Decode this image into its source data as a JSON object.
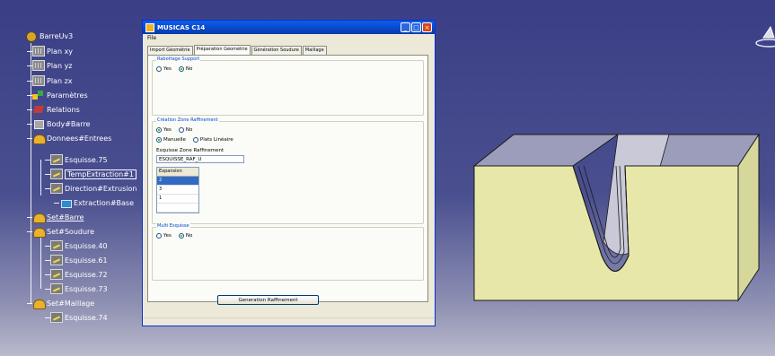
{
  "spec_tree": {
    "root": "BarreUv3",
    "items": [
      {
        "label": "Plan xy",
        "icon": "plane-icon"
      },
      {
        "label": "Plan yz",
        "icon": "plane-icon"
      },
      {
        "label": "Plan zx",
        "icon": "plane-icon"
      },
      {
        "label": "Paramètres",
        "icon": "parameters-icon"
      },
      {
        "label": "Relations",
        "icon": "relations-icon"
      },
      {
        "label": "Body#Barre",
        "icon": "body-icon"
      },
      {
        "label": "Donnees#Entrees",
        "icon": "geometrical-set-icon"
      },
      {
        "label": "Esquisse.75",
        "icon": "sketch-icon"
      },
      {
        "label": "TempExtraction#1",
        "icon": "sketch-icon"
      },
      {
        "label": "Direction#Extrusion",
        "icon": "sketch-icon"
      },
      {
        "label": "Extraction#Base",
        "icon": "extraction-icon"
      },
      {
        "label": "Set#Barre",
        "icon": "geometrical-set-icon"
      },
      {
        "label": "Set#Soudure",
        "icon": "geometrical-set-icon"
      },
      {
        "label": "Esquisse.40",
        "icon": "sketch-icon"
      },
      {
        "label": "Esquisse.61",
        "icon": "sketch-icon"
      },
      {
        "label": "Esquisse.72",
        "icon": "sketch-icon"
      },
      {
        "label": "Esquisse.73",
        "icon": "sketch-icon"
      },
      {
        "label": "Set#Maillage",
        "icon": "geometrical-set-icon"
      },
      {
        "label": "Esquisse.74",
        "icon": "sketch-icon"
      }
    ]
  },
  "dialog": {
    "title": "MUSICAS C14",
    "menu": "File",
    "tabs": [
      "Import Géométrie",
      "Préparation Géométrie",
      "Génération Soudure",
      "Maillage"
    ],
    "active_tab": "Préparation Géométrie",
    "rabotage": {
      "title": "Rabottage Support",
      "options": [
        "Yes",
        "No"
      ],
      "selected": "No"
    },
    "raffinement": {
      "title": "Création Zone Raffinement",
      "options": [
        "Yes",
        "No"
      ],
      "selected": "Yes",
      "type_options": [
        "Manuelle",
        "Plats Linéaire"
      ],
      "type_selected": "Manuelle",
      "sketch_label": "Esquisse Zone Raffinement",
      "sketch_value": "ESQUISSE_RAF_U",
      "table_header": "Expansion",
      "table_rows": [
        "2",
        "3",
        "1",
        ""
      ],
      "selected_row": 0
    },
    "multi_esquisse": {
      "title": "Multi Esquisse",
      "options": [
        "Yes",
        "No"
      ],
      "selected": "No"
    },
    "generate_button": "Generation Raffinement"
  },
  "colors": {
    "model_face_light": "#e6e7a8",
    "model_face_top": "#9b9dba",
    "background_top": "#3a3f86",
    "background_bottom": "#b9bacb"
  }
}
